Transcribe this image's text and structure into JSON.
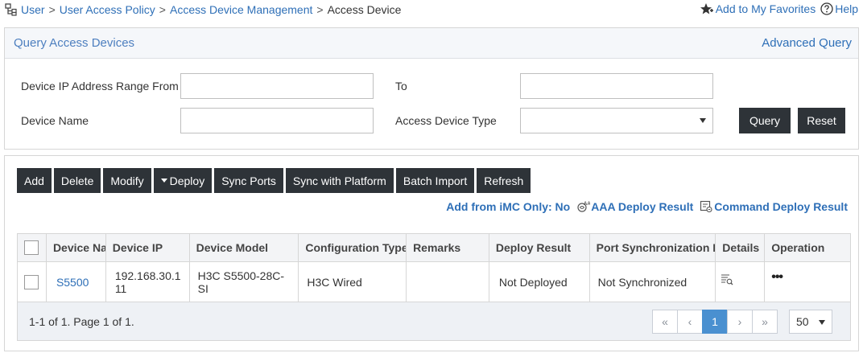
{
  "breadcrumb": {
    "items": [
      "User",
      "User Access Policy",
      "Access Device Management"
    ],
    "separator": ">",
    "current": "Access Device"
  },
  "top_links": {
    "favorites": "Add to My Favorites",
    "help": "Help"
  },
  "query": {
    "title": "Query Access Devices",
    "advanced": "Advanced Query",
    "ip_from_label": "Device IP Address Range From",
    "ip_from_value": "",
    "to_label": "To",
    "to_value": "",
    "device_name_label": "Device Name",
    "device_name_value": "",
    "device_type_label": "Access Device Type",
    "device_type_value": "",
    "query_button": "Query",
    "reset_button": "Reset"
  },
  "toolbar": {
    "add": "Add",
    "delete": "Delete",
    "modify": "Modify",
    "deploy": "Deploy",
    "sync_ports": "Sync Ports",
    "sync_platform": "Sync with Platform",
    "batch_import": "Batch Import",
    "refresh": "Refresh"
  },
  "links": {
    "add_from_imc": "Add from iMC Only: No",
    "aaa_deploy": "AAA Deploy Result",
    "command_deploy": "Command Deploy Result"
  },
  "table": {
    "columns": [
      "Device Name",
      "Device IP",
      "Device Model",
      "Configuration Type",
      "Remarks",
      "Deploy Result",
      "Port Synchronization Result",
      "Details",
      "Operation"
    ],
    "rows": [
      {
        "device_name": "S5500",
        "device_ip": "192.168.30.111",
        "device_model": "H3C S5500-28C-SI",
        "configuration_type": "H3C Wired",
        "remarks": "",
        "deploy_result": "Not Deployed",
        "port_sync": "Not Synchronized",
        "operation": "•••"
      }
    ],
    "summary": "1-1 of 1. Page 1 of 1.",
    "pager": {
      "first": "«",
      "prev": "‹",
      "current": "1",
      "next": "›",
      "last": "»",
      "page_size": "50"
    }
  },
  "icons": {
    "breadcrumb": "hierarchy-icon",
    "favorites": "star-add-icon",
    "help": "help-circle-icon",
    "aaa": "aaa-deploy-icon",
    "command": "command-deploy-icon",
    "details": "details-icon"
  },
  "colors": {
    "link": "#2e6fb7",
    "button_dark": "#2e3338",
    "pager_active": "#4a90d0"
  }
}
